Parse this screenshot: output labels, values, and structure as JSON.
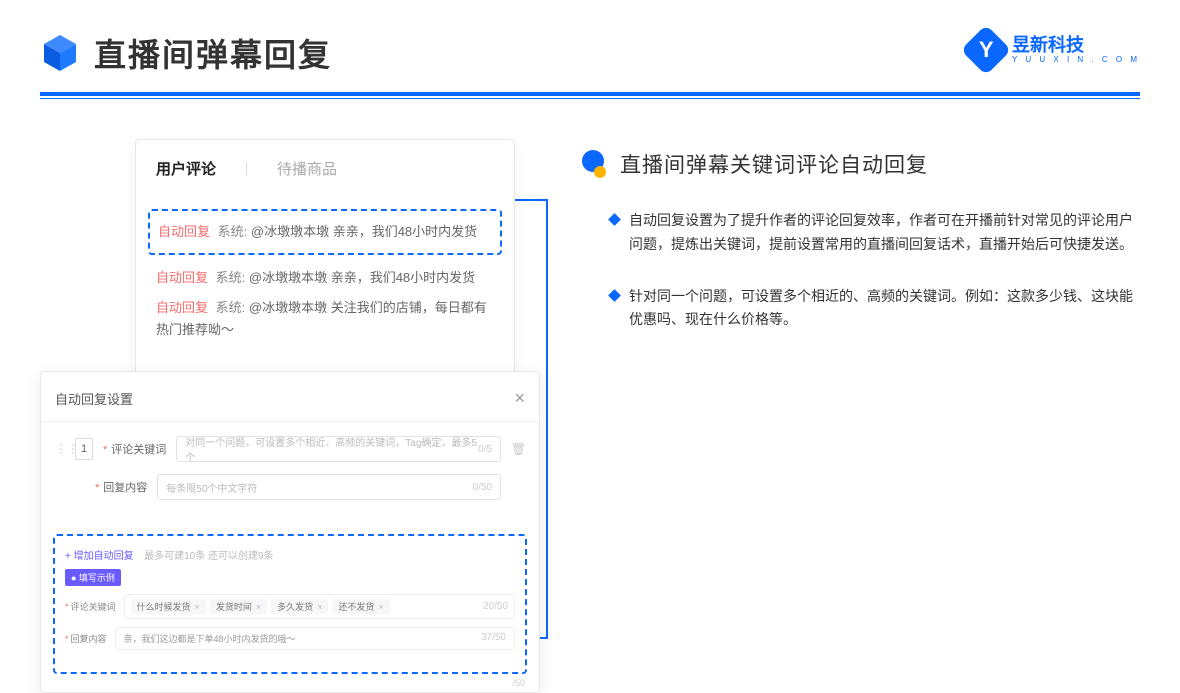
{
  "header": {
    "title": "直播间弹幕回复",
    "brand": {
      "name": "昱新科技",
      "domain": "Y U U X I N . C O M",
      "letter": "Y"
    }
  },
  "commentCard": {
    "tabs": {
      "active": "用户评论",
      "inactive": "待播商品"
    },
    "rows": [
      {
        "tag": "自动回复",
        "sys": "系统:",
        "txt": "@冰墩墩本墩 亲亲，我们48小时内发货"
      },
      {
        "tag": "自动回复",
        "sys": "系统:",
        "txt": "@冰墩墩本墩 亲亲，我们48小时内发货"
      },
      {
        "tag": "自动回复",
        "sys": "系统:",
        "txt": "@冰墩墩本墩 关注我们的店铺，每日都有热门推荐呦～"
      }
    ]
  },
  "settings": {
    "title": "自动回复设置",
    "idx": "1",
    "keywordLabel": "评论关键词",
    "keywordPlaceholder": "对同一个问题，可设置多个相近、高频的关键词，Tag确定，最多5个",
    "keywordCounter": "0/5",
    "contentLabel": "回复内容",
    "contentPlaceholder": "每条限50个中文字符",
    "contentCounter": "0/50",
    "addLink": "+ 增加自动回复",
    "addHint": "最多可建10条 还可以创建9条",
    "exampleBadge": "● 填写示例",
    "ex": {
      "kwLabel": "评论关键词",
      "tags": [
        "什么时候发货",
        "发货时间",
        "多久发货",
        "还不发货"
      ],
      "kwCounter": "20/50",
      "ctLabel": "回复内容",
      "ctText": "亲，我们这边都是下单48小时内发货的哦～",
      "ctCounter": "37/50"
    },
    "brCounter": "/50"
  },
  "right": {
    "sectionTitle": "直播间弹幕关键词评论自动回复",
    "bullets": [
      "自动回复设置为了提升作者的评论回复效率，作者可在开播前针对常见的评论用户问题，提炼出关键词，提前设置常用的直播间回复话术，直播开始后可快捷发送。",
      "针对同一个问题，可设置多个相近的、高频的关键词。例如：这款多少钱、这块能优惠吗、现在什么价格等。"
    ]
  }
}
